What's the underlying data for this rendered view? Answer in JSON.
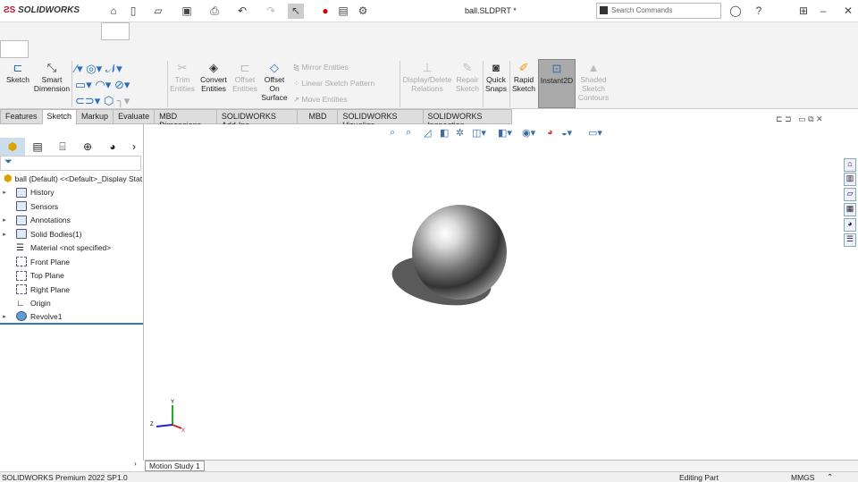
{
  "app": {
    "brand": "SOLIDWORKS",
    "title": "ball.SLDPRT *",
    "search_placeholder": "Search Commands"
  },
  "ribbon": {
    "sketch": "Sketch",
    "smart_dimension": "Smart Dimension",
    "trim": "Trim Entities",
    "convert": "Convert Entities",
    "offset": "Offset Entities",
    "offset_surface": "Offset On Surface",
    "mirror": "Mirror Entities",
    "linear_pattern": "Linear Sketch Pattern",
    "move": "Move Entities",
    "display_delete": "Display/Delete Relations",
    "repair": "Repair Sketch",
    "quick_snaps": "Quick Snaps",
    "rapid_sketch": "Rapid Sketch",
    "instant2d": "Instant2D",
    "shaded": "Shaded Sketch Contours"
  },
  "tabs": [
    "Features",
    "Sketch",
    "Markup",
    "Evaluate",
    "MBD Dimensions",
    "SOLIDWORKS Add-Ins",
    "MBD",
    "SOLIDWORKS Visualize",
    "SOLIDWORKS Inspection"
  ],
  "tree": {
    "root": "ball (Default) <<Default>_Display Stat",
    "items": [
      "History",
      "Sensors",
      "Annotations",
      "Solid Bodies(1)",
      "Material <not specified>",
      "Front Plane",
      "Top Plane",
      "Right Plane",
      "Origin",
      "Revolve1"
    ]
  },
  "motion_tab": "Motion Study 1",
  "status": {
    "version": "SOLIDWORKS Premium 2022 SP1.0",
    "mode": "Editing Part",
    "units": "MMGS"
  },
  "triad": {
    "x": "X",
    "y": "Y",
    "z": "Z"
  }
}
